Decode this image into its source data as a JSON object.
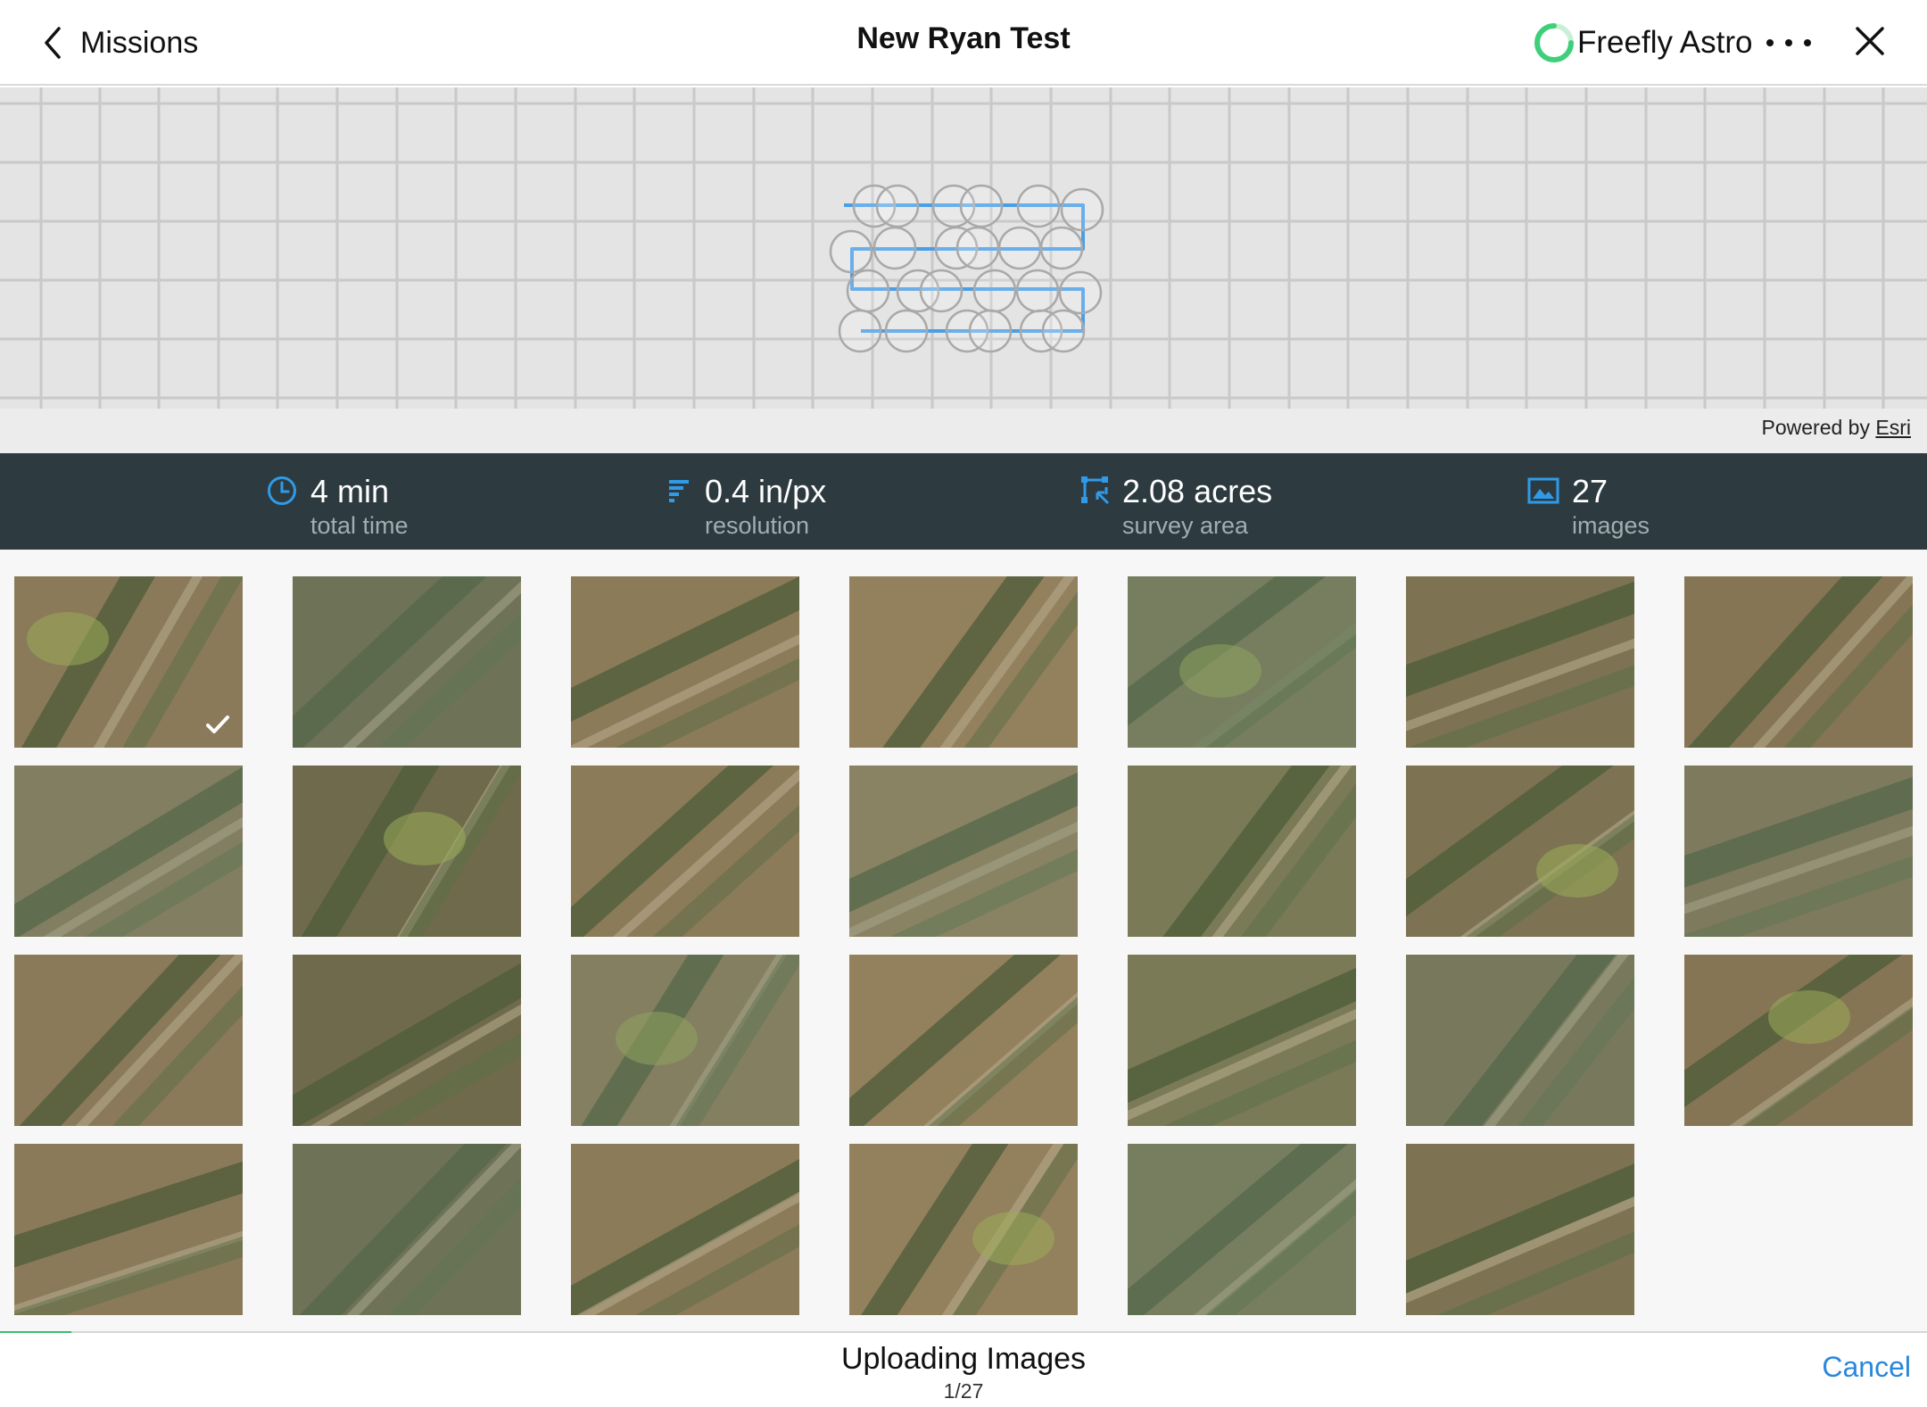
{
  "header": {
    "back_label": "Missions",
    "title": "New Ryan Test",
    "device_name": "Freefly Astro",
    "device_status_color": "#3fcf7a"
  },
  "map": {
    "attribution_prefix": "Powered by",
    "attribution_link": "Esri",
    "flight_path_color": "#4a9ee6"
  },
  "stats": [
    {
      "icon": "clock-icon",
      "value": "4 min",
      "label": "total time"
    },
    {
      "icon": "resolution-icon",
      "value": "0.4 in/px",
      "label": "resolution"
    },
    {
      "icon": "survey-area-icon",
      "value": "2.08 acres",
      "label": "survey area"
    },
    {
      "icon": "image-icon",
      "value": "27",
      "label": "images"
    }
  ],
  "gallery": {
    "image_count": 27,
    "uploaded_image_index": 1
  },
  "upload": {
    "title": "Uploading Images",
    "count": "1/27",
    "progress": 0.037,
    "cancel_label": "Cancel"
  },
  "colors": {
    "accent": "#2a87db",
    "stats_bar": "#2d3b41",
    "stat_icon": "#2f9be8",
    "progress": "#3dbd6e"
  }
}
